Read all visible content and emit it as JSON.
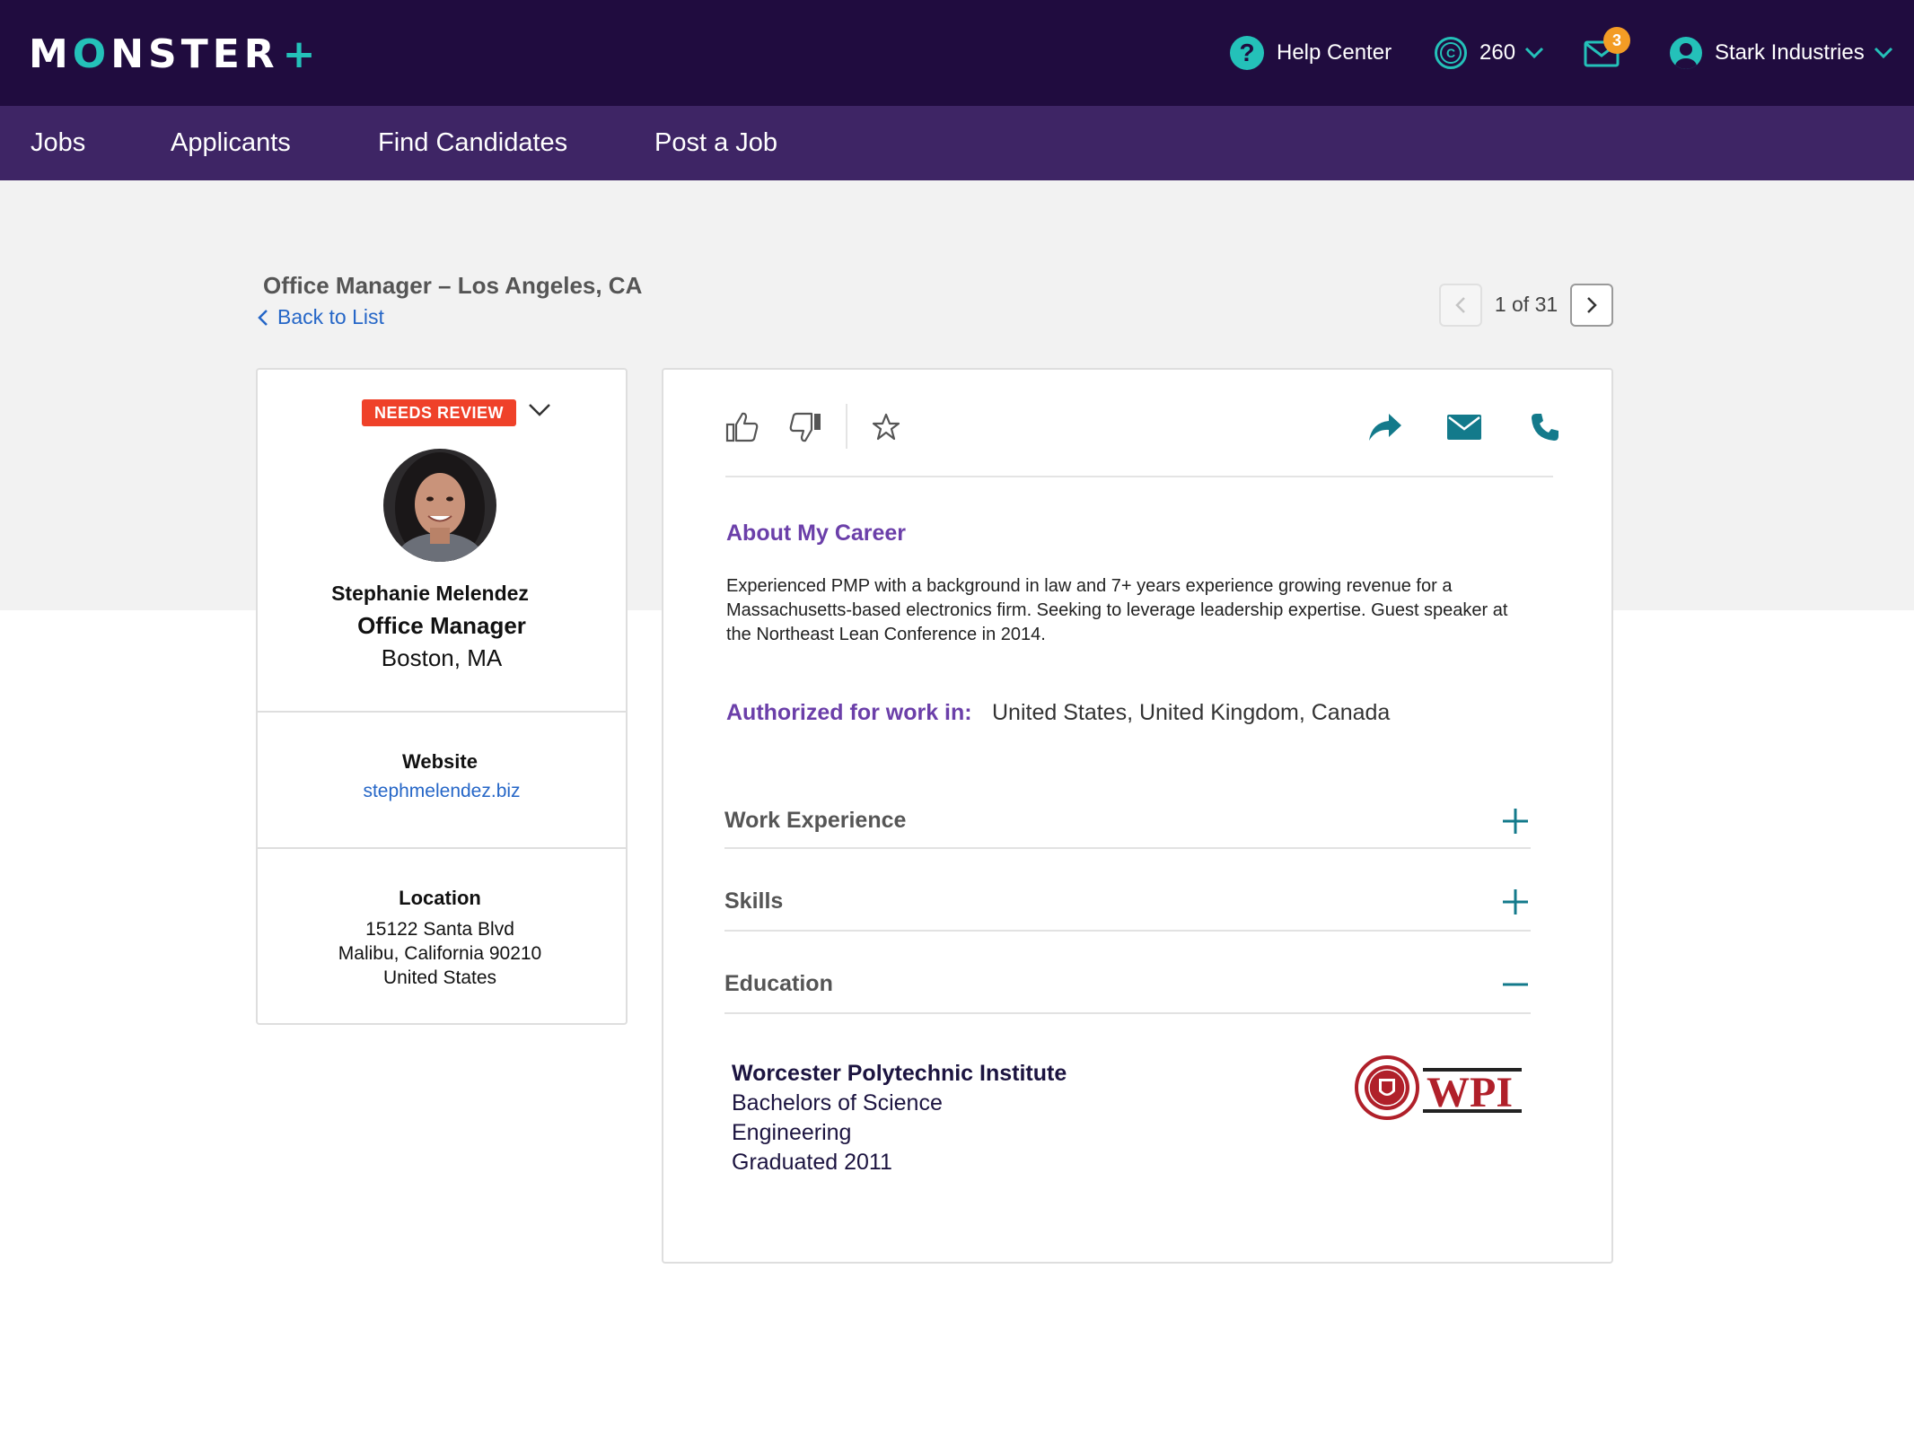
{
  "brand": {
    "name_m": "M",
    "name_o": "O",
    "name_rest": "NSTER",
    "plus": "+"
  },
  "header": {
    "help_label": "Help Center",
    "credits_value": "260",
    "mail_badge": "3",
    "account_name": "Stark Industries"
  },
  "nav": {
    "jobs": "Jobs",
    "applicants": "Applicants",
    "find_candidates": "Find Candidates",
    "post_job": "Post a Job"
  },
  "job": {
    "title": "Office Manager – Los Angeles, CA",
    "back_label": "Back to List"
  },
  "pager": {
    "count": "1 of 31"
  },
  "candidate": {
    "status": "NEEDS REVIEW",
    "name": "Stephanie Melendez",
    "role": "Office Manager",
    "location": "Boston, MA",
    "website_label": "Website",
    "website": "stephmelendez.biz",
    "location_label": "Location",
    "address_line1": "15122 Santa Blvd",
    "address_line2": "Malibu, California 90210",
    "address_line3": "United States"
  },
  "profile": {
    "about_heading": "About My Career",
    "about_text": "Experienced PMP with a background in law and 7+ years experience growing revenue for a Massachusetts-based electronics firm. Seeking to leverage leadership expertise. Guest speaker at the Northeast Lean Conference in 2014.",
    "authorized_label": "Authorized for work in:",
    "authorized_value": "United States, United Kingdom, Canada",
    "sections": {
      "work": "Work Experience",
      "skills": "Skills",
      "education": "Education"
    },
    "education": {
      "school": "Worcester Polytechnic Institute",
      "degree": "Bachelors of Science",
      "field": "Engineering",
      "graduated": "Graduated 2011",
      "logo_text": "WPI"
    }
  },
  "colors": {
    "topbar": "#200c3f",
    "navbar": "#3e2565",
    "accent_teal": "#24c1b9",
    "action_teal": "#137a8b",
    "purple_heading": "#6b3fa9",
    "badge_red": "#ef4129",
    "badge_orange": "#f39c25",
    "link_blue": "#2566c7"
  },
  "icons": [
    "help-icon",
    "credits-icon",
    "chevron-down-icon",
    "mail-icon",
    "account-icon",
    "chevron-left-icon",
    "chevron-right-icon",
    "thumbs-up-icon",
    "thumbs-down-icon",
    "star-icon",
    "share-icon",
    "email-icon",
    "phone-icon",
    "plus-icon",
    "minus-icon"
  ]
}
